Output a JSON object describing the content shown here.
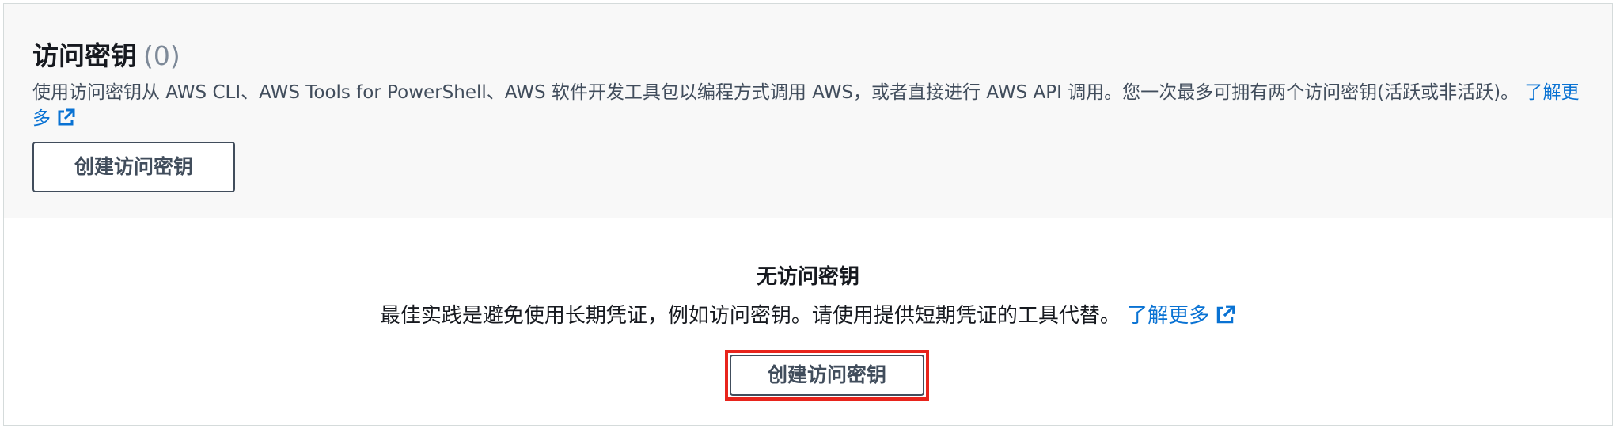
{
  "header": {
    "title": "访问密钥",
    "count": "(0)",
    "description": "使用访问密钥从 AWS CLI、AWS Tools for PowerShell、AWS 软件开发工具包以编程方式调用 AWS，或者直接进行 AWS API 调用。您一次最多可拥有两个访问密钥(活跃或非活跃)。",
    "learn_more_label": "了解更多",
    "learn_more_icon": "external-link-icon",
    "create_button_label": "创建访问密钥"
  },
  "empty_state": {
    "title": "无访问密钥",
    "description": "最佳实践是避免使用长期凭证，例如访问密钥。请使用提供短期凭证的工具代替。",
    "learn_more_label": "了解更多",
    "learn_more_icon": "external-link-icon",
    "create_button_label": "创建访问密钥",
    "highlight_color": "#e8241c"
  },
  "colors": {
    "link": "#0972d3",
    "header_background": "#f8f8f8",
    "button_border": "#414d5c"
  }
}
